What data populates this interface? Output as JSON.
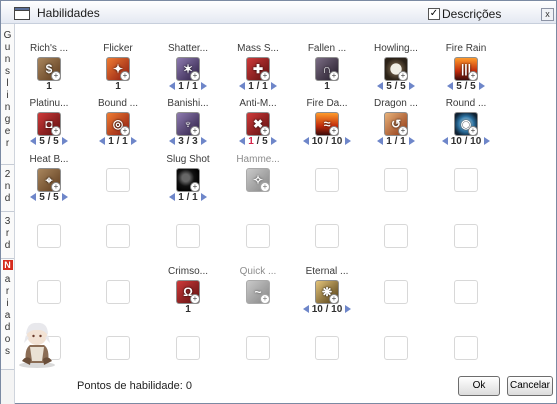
{
  "window": {
    "title": "Habilidades",
    "descriptions_label": "Descrições",
    "descriptions_checked": true,
    "close_glyph": "x"
  },
  "side_tabs": [
    {
      "label": "Gunslinger"
    },
    {
      "label": "2nd"
    },
    {
      "label": "3rd"
    },
    {
      "badge": "N",
      "label": "ariados"
    }
  ],
  "skills": [
    {
      "name": "Rich's ...",
      "icon": "coin-bag-icon",
      "color": "c-brown",
      "level": "1",
      "arrows": false,
      "dim": false
    },
    {
      "name": "Flicker",
      "icon": "flame-flicker-icon",
      "color": "c-red",
      "level": "1",
      "arrows": false,
      "dim": false
    },
    {
      "name": "Shatter...",
      "icon": "shatter-icon",
      "color": "c-purple",
      "level": "1 / 1",
      "arrows": true,
      "dim": false
    },
    {
      "name": "Mass S...",
      "icon": "mass-spiral-icon",
      "color": "c-redmark",
      "level": "1 / 1",
      "arrows": true,
      "dim": false
    },
    {
      "name": "Fallen ...",
      "icon": "fallen-angel-icon",
      "color": "c-dark",
      "level": "1",
      "arrows": false,
      "dim": false
    },
    {
      "name": "Howling...",
      "icon": "clock-icon",
      "color": "c-clock",
      "level": "5 / 5",
      "arrows": true,
      "dim": false
    },
    {
      "name": "Fire Rain",
      "icon": "fire-rain-icon",
      "color": "c-fire",
      "level": "5 / 5",
      "arrows": true,
      "dim": false
    },
    {
      "name": "Platinu...",
      "icon": "platinum-altar-icon",
      "color": "c-redmark",
      "level": "5 / 5",
      "arrows": true,
      "dim": false
    },
    {
      "name": "Bound ...",
      "icon": "bound-trap-icon",
      "color": "c-red",
      "level": "1 / 1",
      "arrows": true,
      "dim": false
    },
    {
      "name": "Banishi...",
      "icon": "banishing-buster-icon",
      "color": "c-purple",
      "level": "3 / 3",
      "arrows": true,
      "dim": false
    },
    {
      "name": "Anti-M...",
      "icon": "anti-material-icon",
      "color": "c-redmark",
      "level": "1 / 5",
      "level_cur_red": true,
      "arrows": true,
      "dim": false
    },
    {
      "name": "Fire Da...",
      "icon": "fire-dance-icon",
      "color": "c-fire",
      "level": "10 / 10",
      "arrows": true,
      "dim": false
    },
    {
      "name": "Dragon ...",
      "icon": "dragon-tail-icon",
      "color": "c-swirl",
      "level": "1 / 1",
      "arrows": true,
      "dim": false
    },
    {
      "name": "Round ...",
      "icon": "round-trip-icon",
      "color": "c-blue",
      "level": "10 / 10",
      "arrows": true,
      "dim": false
    },
    {
      "name": "Heat B...",
      "icon": "heat-barrel-icon",
      "color": "c-brown",
      "level": "5 / 5",
      "arrows": true,
      "dim": false
    },
    {
      "name": "Slug Shot",
      "icon": "slug-shot-icon",
      "color": "c-black",
      "level": "1 / 1",
      "arrows": true,
      "dim": false
    },
    {
      "name": "Hamme...",
      "icon": "hammer-icon",
      "color": "c-grayghost",
      "level": "",
      "arrows": false,
      "dim": true
    },
    {
      "name": "Crimso...",
      "icon": "crimson-marker-icon",
      "color": "c-redmark",
      "level": "1",
      "arrows": false,
      "dim": false
    },
    {
      "name": "Quick ...",
      "icon": "quick-dodge-icon",
      "color": "c-grayghost",
      "level": "",
      "arrows": false,
      "dim": true
    },
    {
      "name": "Eternal ...",
      "icon": "eternal-chain-icon",
      "color": "c-gold",
      "level": "10 / 10",
      "arrows": true,
      "dim": false
    }
  ],
  "footer": {
    "points_label": "Pontos de habilidade: 0",
    "ok_label": "Ok",
    "cancel_label": "Cancelar"
  },
  "colors": {
    "arrow": "#6e86c9",
    "level_red": "#d42348",
    "tab_badge": "#d62b1d"
  }
}
